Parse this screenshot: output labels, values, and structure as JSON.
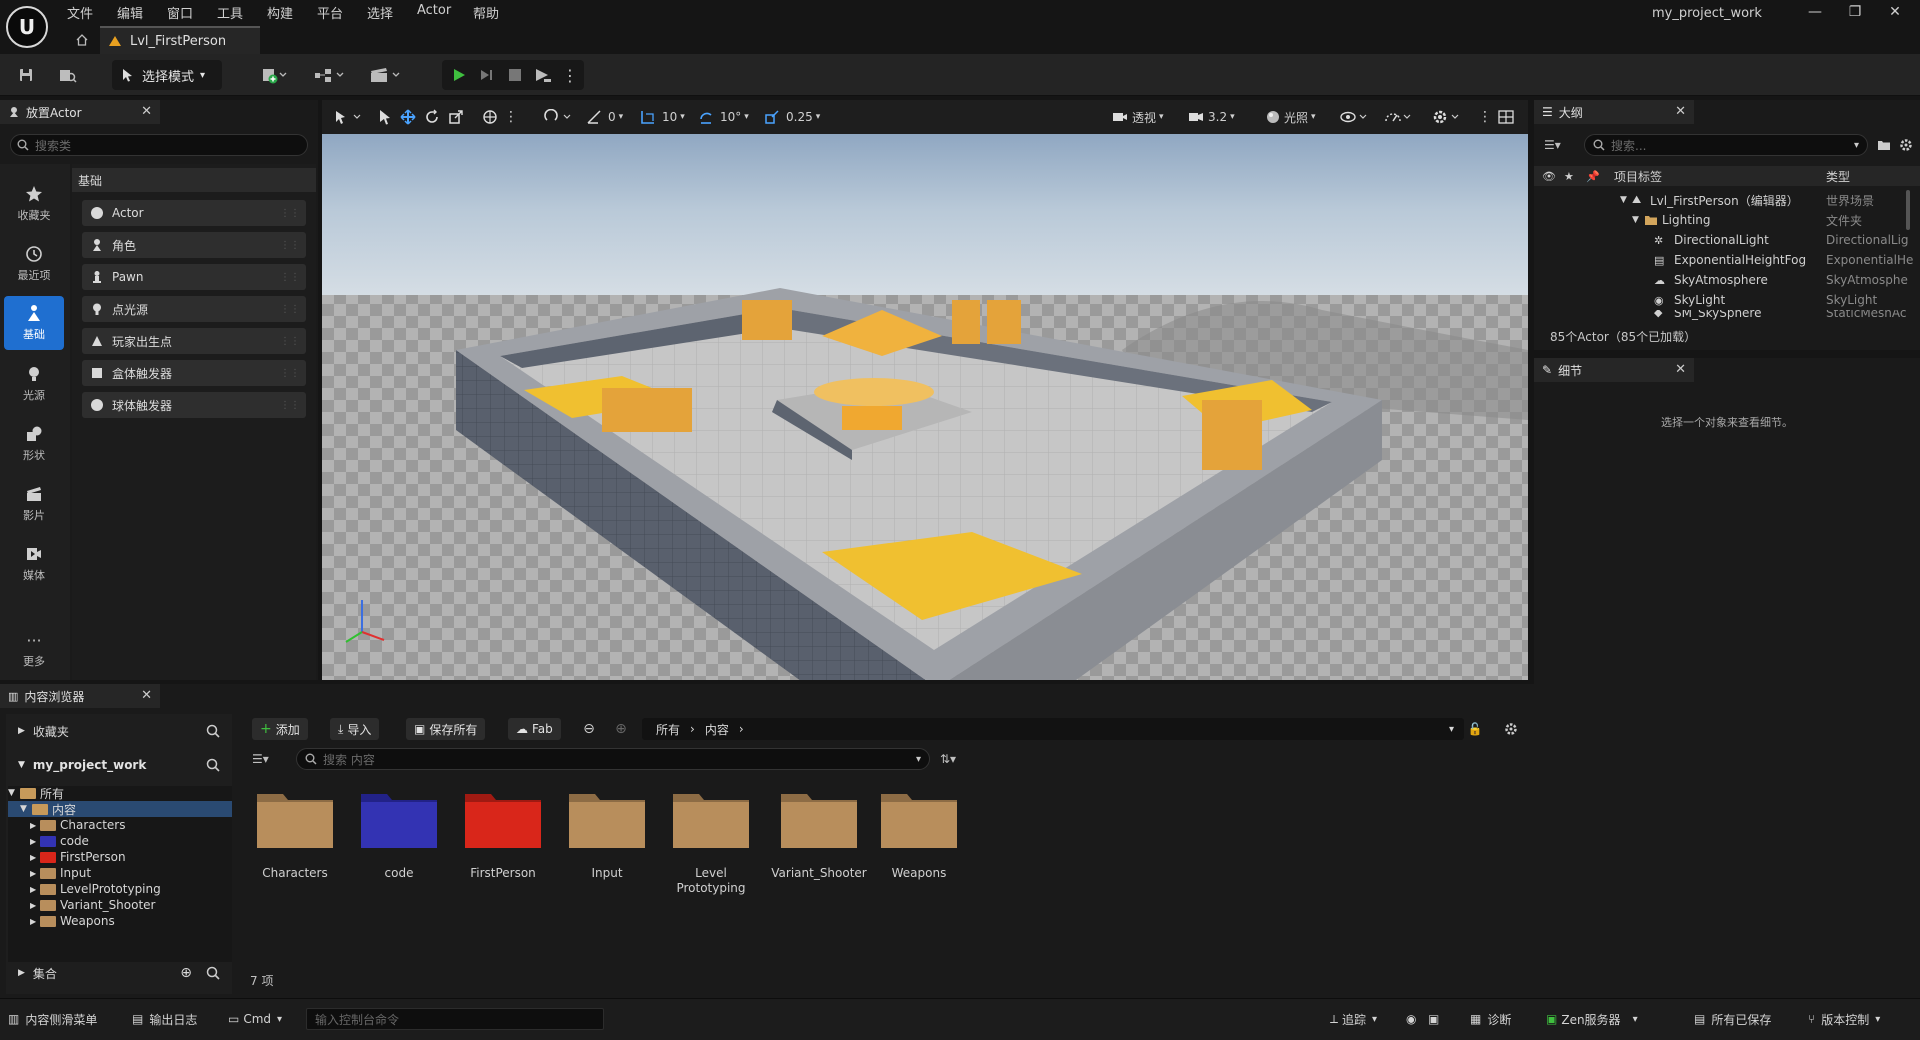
{
  "app": {
    "logo": "U",
    "project_name": "my_project_work"
  },
  "menu": [
    "文件",
    "编辑",
    "窗口",
    "工具",
    "构建",
    "平台",
    "选择",
    "Actor",
    "帮助"
  ],
  "document_tab": {
    "label": "Lvl_FirstPerson"
  },
  "toolbar": {
    "mode_label": "选择模式"
  },
  "place_actor": {
    "title": "放置Actor",
    "search_placeholder": "搜索类",
    "categories": [
      {
        "label": "收藏夹",
        "icon": "star-icon"
      },
      {
        "label": "最近项",
        "icon": "clock-icon"
      },
      {
        "label": "基础",
        "icon": "basic-actor-icon"
      },
      {
        "label": "光源",
        "icon": "light-icon"
      },
      {
        "label": "形状",
        "icon": "shapes-icon"
      },
      {
        "label": "影片",
        "icon": "clapper-icon"
      },
      {
        "label": "媒体",
        "icon": "media-icon"
      },
      {
        "label": "更多",
        "icon": "more-icon"
      }
    ],
    "active_category": "基础",
    "items": [
      "Actor",
      "角色",
      "Pawn",
      "点光源",
      "玩家出生点",
      "盒体触发器",
      "球体触发器"
    ]
  },
  "viewport": {
    "snap_angle_value": "0",
    "grid_snap": "10",
    "rotation_snap": "10°",
    "scale_snap": "0.25",
    "view_mode": "透视",
    "camera_speed": "3.2",
    "lit_mode": "光照"
  },
  "outliner": {
    "title": "大纲",
    "search_placeholder": "搜索...",
    "col_label": "项目标签",
    "col_type": "类型",
    "rows": [
      {
        "name": "Lvl_FirstPerson（编辑器）",
        "type": "世界场景",
        "indent": 0
      },
      {
        "name": "Lighting",
        "type": "文件夹",
        "indent": 1
      },
      {
        "name": "DirectionalLight",
        "type": "DirectionalLig",
        "indent": 2
      },
      {
        "name": "ExponentialHeightFog",
        "type": "ExponentialHe",
        "indent": 2
      },
      {
        "name": "SkyAtmosphere",
        "type": "SkyAtmosphe",
        "indent": 2
      },
      {
        "name": "SkyLight",
        "type": "SkyLight",
        "indent": 2
      },
      {
        "name": "SM_SkySphere",
        "type": "StaticMeshAc",
        "indent": 2
      }
    ],
    "footer": "85个Actor（85个已加载）"
  },
  "details": {
    "title": "细节",
    "empty_text": "选择一个对象来查看细节。"
  },
  "content_browser": {
    "title": "内容浏览器",
    "favorites": "收藏夹",
    "project": "my_project_work",
    "tree": [
      {
        "label": "所有",
        "indent": 0,
        "color": "#c79a5a"
      },
      {
        "label": "内容",
        "indent": 1,
        "color": "#c79a5a"
      },
      {
        "label": "Characters",
        "indent": 2,
        "color": "#b88e5c"
      },
      {
        "label": "code",
        "indent": 2,
        "color": "#3333b3"
      },
      {
        "label": "FirstPerson",
        "indent": 2,
        "color": "#d9261a"
      },
      {
        "label": "Input",
        "indent": 2,
        "color": "#b88e5c"
      },
      {
        "label": "LevelPrototyping",
        "indent": 2,
        "color": "#b88e5c"
      },
      {
        "label": "Variant_Shooter",
        "indent": 2,
        "color": "#b88e5c"
      },
      {
        "label": "Weapons",
        "indent": 2,
        "color": "#b88e5c"
      }
    ],
    "collections": "集合",
    "buttons": {
      "add": "添加",
      "import": "导入",
      "save_all": "保存所有",
      "fab": "Fab"
    },
    "path": [
      "所有",
      "内容"
    ],
    "search_placeholder": "搜索 内容",
    "assets": [
      {
        "name": "Characters",
        "color": "#b88e5c"
      },
      {
        "name": "code",
        "color": "#3333b3"
      },
      {
        "name": "FirstPerson",
        "color": "#d9261a"
      },
      {
        "name": "Input",
        "color": "#b88e5c"
      },
      {
        "name": "Level\nPrototyping",
        "color": "#b88e5c"
      },
      {
        "name": "Variant_Shooter",
        "color": "#b88e5c"
      },
      {
        "name": "Weapons",
        "color": "#b88e5c"
      }
    ],
    "count": "7 项"
  },
  "status": {
    "content_drawer": "内容侧滑菜单",
    "output_log": "输出日志",
    "cmd": "Cmd",
    "console_placeholder": "输入控制台命令",
    "trace": "追踪",
    "diagnostics": "诊断",
    "zen": "Zen服务器",
    "all_saved": "所有已保存",
    "source_control": "版本控制"
  }
}
